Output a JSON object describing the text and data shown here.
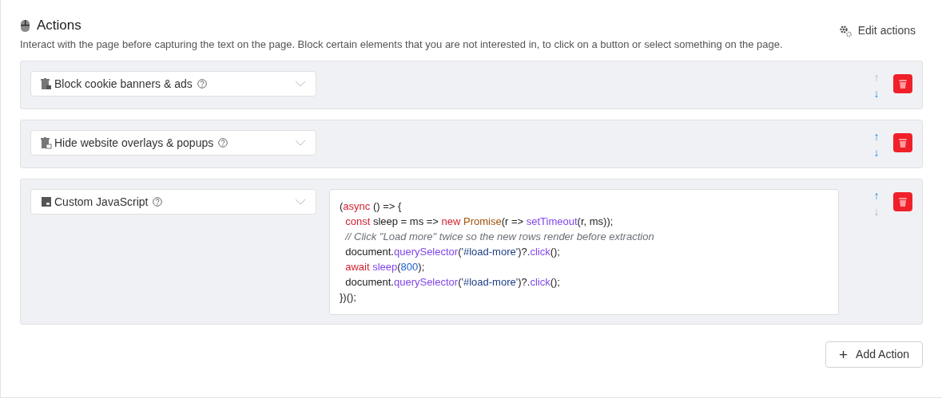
{
  "header": {
    "title": "Actions",
    "description": "Interact with the page before capturing the text on the page. Block certain elements that you are not interested in, to click on a button or select something on the page.",
    "edit_label": "Edit actions"
  },
  "actions": [
    {
      "kind": "block",
      "label": "Block cookie banners & ads",
      "up": {
        "glyph": "↑",
        "disabled": true
      },
      "down": {
        "glyph": "↓",
        "disabled": false
      }
    },
    {
      "kind": "hide",
      "label": "Hide website overlays & popups",
      "up": {
        "glyph": "↑",
        "disabled": false
      },
      "down": {
        "glyph": "↓",
        "disabled": false
      }
    },
    {
      "kind": "js",
      "label": "Custom JavaScript",
      "up": {
        "glyph": "↑",
        "disabled": false
      },
      "down": {
        "glyph": "↓",
        "disabled": true
      },
      "code": [
        [
          {
            "text": "(",
            "kind": "plain"
          },
          {
            "text": "async",
            "kind": "keyword"
          },
          {
            "text": " () => {",
            "kind": "plain"
          }
        ],
        [
          {
            "text": "  const",
            "kind": "keyword"
          },
          {
            "text": " sleep = ms => ",
            "kind": "plain"
          },
          {
            "text": "new ",
            "kind": "keyword"
          },
          {
            "text": "Promise",
            "kind": "class"
          },
          {
            "text": "(r => ",
            "kind": "plain"
          },
          {
            "text": "setTimeout",
            "kind": "func"
          },
          {
            "text": "(r, ms));",
            "kind": "plain"
          }
        ],
        [
          {
            "text": "  // Click \"Load more\" twice so the new rows render before extraction",
            "kind": "comment"
          }
        ],
        [
          {
            "text": "  document.",
            "kind": "plain"
          },
          {
            "text": "querySelector",
            "kind": "func"
          },
          {
            "text": "(",
            "kind": "plain"
          },
          {
            "text": "'#load-more'",
            "kind": "string"
          },
          {
            "text": ")?.",
            "kind": "plain"
          },
          {
            "text": "click",
            "kind": "func"
          },
          {
            "text": "();",
            "kind": "plain"
          }
        ],
        [
          {
            "text": "  await ",
            "kind": "keyword"
          },
          {
            "text": "sleep",
            "kind": "func"
          },
          {
            "text": "(",
            "kind": "plain"
          },
          {
            "text": "800",
            "kind": "number"
          },
          {
            "text": ");",
            "kind": "plain"
          }
        ],
        [
          {
            "text": "  document.",
            "kind": "plain"
          },
          {
            "text": "querySelector",
            "kind": "func"
          },
          {
            "text": "(",
            "kind": "plain"
          },
          {
            "text": "'#load-more'",
            "kind": "string"
          },
          {
            "text": ")?.",
            "kind": "plain"
          },
          {
            "text": "click",
            "kind": "func"
          },
          {
            "text": "();",
            "kind": "plain"
          }
        ],
        [
          {
            "text": "})();",
            "kind": "plain"
          }
        ]
      ]
    }
  ],
  "add_button": {
    "glyph": "+",
    "label": "Add Action"
  }
}
